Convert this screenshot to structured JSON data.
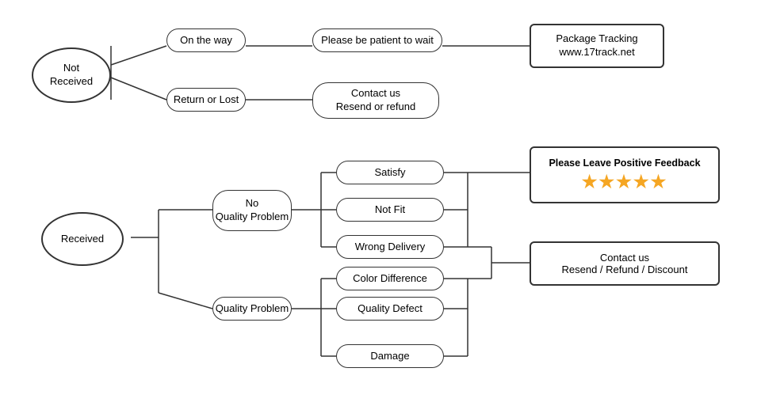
{
  "nodes": {
    "not_received": {
      "label": "Not\nReceived"
    },
    "on_the_way": {
      "label": "On the way"
    },
    "return_or_lost": {
      "label": "Return or Lost"
    },
    "be_patient": {
      "label": "Please be patient to wait"
    },
    "contact_resend_refund": {
      "label": "Contact us\nResend or refund"
    },
    "package_tracking": {
      "label": "Package Tracking\nwww.17track.net"
    },
    "received": {
      "label": "Received"
    },
    "no_quality_problem": {
      "label": "No\nQuality Problem"
    },
    "quality_problem": {
      "label": "Quality Problem"
    },
    "satisfy": {
      "label": "Satisfy"
    },
    "not_fit": {
      "label": "Not Fit"
    },
    "wrong_delivery": {
      "label": "Wrong Delivery"
    },
    "color_difference": {
      "label": "Color Difference"
    },
    "quality_defect": {
      "label": "Quality Defect"
    },
    "damage": {
      "label": "Damage"
    },
    "feedback": {
      "label": "Please Leave Positive Feedback",
      "stars": "★★★★★"
    },
    "contact_refund": {
      "label": "Contact us\nResend / Refund / Discount"
    }
  }
}
